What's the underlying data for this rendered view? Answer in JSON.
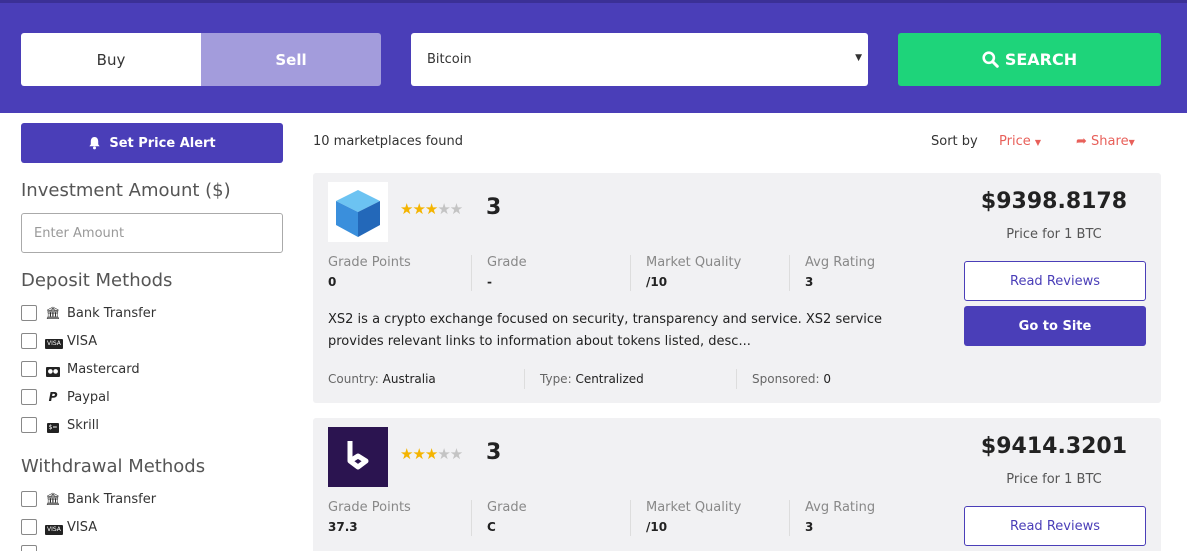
{
  "header": {
    "buy_label": "Buy",
    "sell_label": "Sell",
    "coin_selected": "Bitcoin",
    "search_label": "SEARCH"
  },
  "sidebar": {
    "alert_label": "Set Price Alert",
    "investment_title": "Investment Amount ($)",
    "amount_placeholder": "Enter Amount",
    "deposit_title": "Deposit Methods",
    "deposit_methods": [
      "Bank Transfer",
      "VISA",
      "Mastercard",
      "Paypal",
      "Skrill"
    ],
    "withdrawal_title": "Withdrawal Methods",
    "withdrawal_methods": [
      "Bank Transfer",
      "VISA"
    ]
  },
  "results": {
    "found_text": "10 marketplaces found",
    "sort_label": "Sort by",
    "sort_value": "Price",
    "share_label": "Share"
  },
  "labels": {
    "grade_points": "Grade Points",
    "grade": "Grade",
    "market_quality": "Market Quality",
    "avg_rating": "Avg Rating",
    "country": "Country:",
    "type": "Type:",
    "sponsored": "Sponsored:",
    "price_for": "Price for 1 BTC",
    "read_reviews": "Read Reviews",
    "go_to_site": "Go to Site"
  },
  "cards": [
    {
      "stars": 3,
      "rating": "3",
      "grade_points": "0",
      "grade": "-",
      "market_quality": "/10",
      "avg_rating": "3",
      "description": "XS2 is a crypto exchange focused on security, transparency and service.  XS2 service provides relevant links to information about tokens listed, desc...",
      "country": "Australia",
      "type": "Centralized",
      "sponsored": "0",
      "price": "$9398.8178"
    },
    {
      "stars": 3,
      "rating": "3",
      "grade_points": "37.3",
      "grade": "C",
      "market_quality": "/10",
      "avg_rating": "3",
      "price": "$9414.3201"
    }
  ],
  "colors": {
    "brand": "#4a3eb8",
    "search": "#1ed47a",
    "accent": "#e8605a"
  }
}
